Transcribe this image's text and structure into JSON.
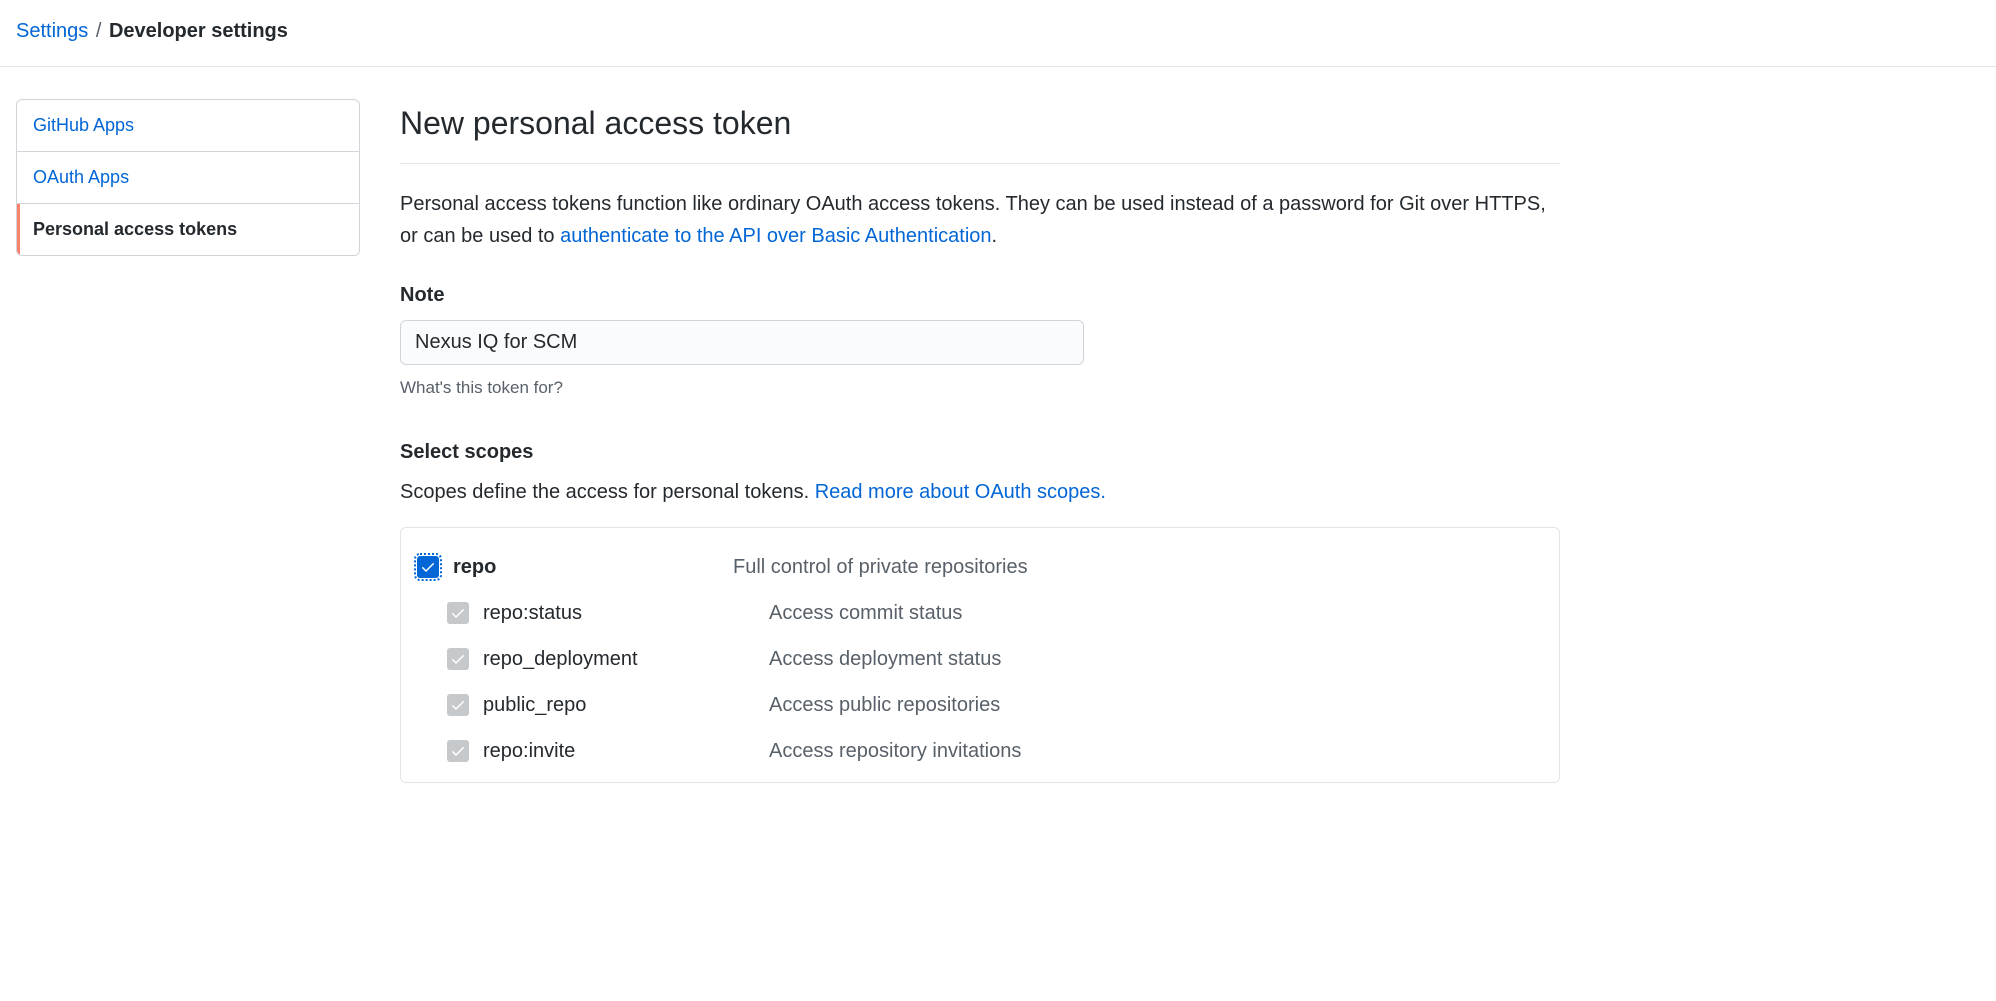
{
  "breadcrumb": {
    "settings": "Settings",
    "separator": "/",
    "current": "Developer settings"
  },
  "sidebar": {
    "items": [
      {
        "label": "GitHub Apps",
        "active": false
      },
      {
        "label": "OAuth Apps",
        "active": false
      },
      {
        "label": "Personal access tokens",
        "active": true
      }
    ]
  },
  "main": {
    "title": "New personal access token",
    "description_before": "Personal access tokens function like ordinary OAuth access tokens. They can be used instead of a password for Git over HTTPS, or can be used to ",
    "description_link": "authenticate to the API over Basic Authentication",
    "description_after": ".",
    "note_label": "Note",
    "note_value": "Nexus IQ for SCM",
    "note_hint": "What's this token for?",
    "scopes_label": "Select scopes",
    "scopes_desc_before": "Scopes define the access for personal tokens. ",
    "scopes_desc_link": "Read more about OAuth scopes.",
    "scopes": [
      {
        "name": "repo",
        "desc": "Full control of private repositories",
        "child": false,
        "primary": true
      },
      {
        "name": "repo:status",
        "desc": "Access commit status",
        "child": true,
        "primary": false
      },
      {
        "name": "repo_deployment",
        "desc": "Access deployment status",
        "child": true,
        "primary": false
      },
      {
        "name": "public_repo",
        "desc": "Access public repositories",
        "child": true,
        "primary": false
      },
      {
        "name": "repo:invite",
        "desc": "Access repository invitations",
        "child": true,
        "primary": false
      }
    ]
  }
}
